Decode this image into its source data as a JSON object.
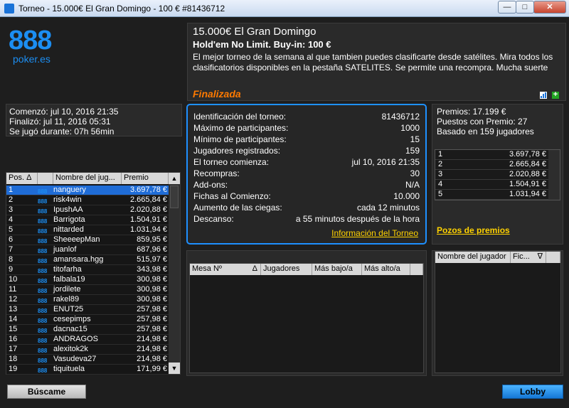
{
  "window": {
    "title": "Torneo - 15.000€ El Gran Domingo  - 100 € #81436712",
    "minimize_label": "—",
    "maximize_label": "□",
    "close_label": "✕"
  },
  "logo": {
    "main": "888",
    "sub": "poker.es"
  },
  "header": {
    "title": "15.000€ El Gran Domingo",
    "subtitle": "Hold'em No Limit. Buy-in: 100 €",
    "description": "El mejor torneo de la semana al que tambien puedes clasificarte desde satélites. Mira todos los clasificatorios disponibles en la pestaña SATELITES.  Se permite una recompra. Mucha suerte",
    "status": "Finalizada",
    "add_label": "+"
  },
  "times": {
    "started": "Comenzó: jul 10, 2016 21:35",
    "ended": "Finalizó: jul 11, 2016 05:31",
    "duration": "Se jugó durante: 07h 56min"
  },
  "info": {
    "rows": [
      {
        "label": "Identificación del torneo:",
        "value": "81436712"
      },
      {
        "label": "Máximo de participantes:",
        "value": "1000"
      },
      {
        "label": "Mínimo de participantes:",
        "value": "15"
      },
      {
        "label": "Jugadores registrados:",
        "value": "159"
      },
      {
        "label": "El torneo comienza:",
        "value": "jul 10, 2016 21:35"
      },
      {
        "label": "Recompras:",
        "value": "30"
      },
      {
        "label": "Add-ons:",
        "value": "N/A"
      },
      {
        "label": "Fichas al Comienzo:",
        "value": "10.000"
      },
      {
        "label": "Aumento de las ciegas:",
        "value": "cada 12 minutos"
      },
      {
        "label": "Descanso:",
        "value": "a 55 minutos después de la hora"
      }
    ],
    "link": "Información del Torneo"
  },
  "prizes": {
    "total": "Premios: 17.199 €",
    "places": "Puestos con Premio: 27",
    "based_on": "Basado en 159 jugadores",
    "list": [
      {
        "pos": "1",
        "value": "3.697,78 €"
      },
      {
        "pos": "2",
        "value": "2.665,84 €"
      },
      {
        "pos": "3",
        "value": "2.020,88 €"
      },
      {
        "pos": "4",
        "value": "1.504,91 €"
      },
      {
        "pos": "5",
        "value": "1.031,94 €"
      }
    ],
    "pools_link": "Pozos de premios"
  },
  "players": {
    "headers": {
      "pos": "Pos.",
      "name": "Nombre del jug...",
      "prize": "Premio"
    },
    "badge": "888",
    "rows": [
      {
        "pos": "1",
        "name": "nanguery",
        "prize": "3.697,78 €"
      },
      {
        "pos": "2",
        "name": "risk4win",
        "prize": "2.665,84 €"
      },
      {
        "pos": "3",
        "name": "IpushAA",
        "prize": "2.020,88 €"
      },
      {
        "pos": "4",
        "name": "Barrigota",
        "prize": "1.504,91 €"
      },
      {
        "pos": "5",
        "name": "nittarded",
        "prize": "1.031,94 €"
      },
      {
        "pos": "6",
        "name": "SheeeepMan",
        "prize": "859,95 €"
      },
      {
        "pos": "7",
        "name": "juanlof",
        "prize": "687,96 €"
      },
      {
        "pos": "8",
        "name": "amansara.hgg",
        "prize": "515,97 €"
      },
      {
        "pos": "9",
        "name": "titofarha",
        "prize": "343,98 €"
      },
      {
        "pos": "10",
        "name": "falbala19",
        "prize": "300,98 €"
      },
      {
        "pos": "11",
        "name": "jordilete",
        "prize": "300,98 €"
      },
      {
        "pos": "12",
        "name": "rakel89",
        "prize": "300,98 €"
      },
      {
        "pos": "13",
        "name": "ENUT25",
        "prize": "257,98 €"
      },
      {
        "pos": "14",
        "name": "cesepimps",
        "prize": "257,98 €"
      },
      {
        "pos": "15",
        "name": "dacnac15",
        "prize": "257,98 €"
      },
      {
        "pos": "16",
        "name": "ANDRAGOS",
        "prize": "214,98 €"
      },
      {
        "pos": "17",
        "name": "alexitok2k",
        "prize": "214,98 €"
      },
      {
        "pos": "18",
        "name": "Vasudeva27",
        "prize": "214,98 €"
      },
      {
        "pos": "19",
        "name": "tiquituela",
        "prize": "171,99 €"
      }
    ]
  },
  "tables": {
    "headers": {
      "table": "Mesa Nº",
      "players": "Jugadores",
      "lowest": "Más bajo/a",
      "highest": "Más alto/a"
    }
  },
  "table_players": {
    "headers": {
      "name": "Nombre del jugador",
      "chips": "Fic..."
    }
  },
  "buttons": {
    "find_me": "Búscame",
    "lobby": "Lobby"
  },
  "colors": {
    "accent": "#1e90ff",
    "status": "#ff7a00",
    "link": "#ffd200",
    "selection": "#1f6cd6"
  }
}
